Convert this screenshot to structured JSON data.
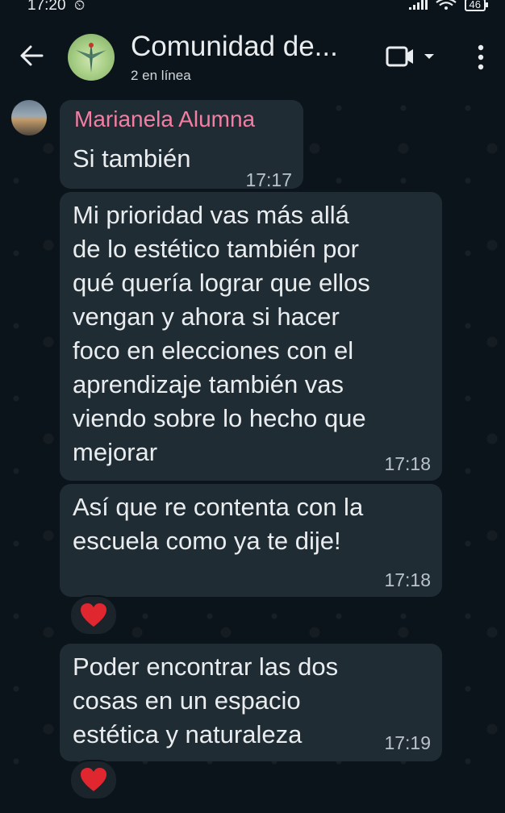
{
  "status": {
    "time": "17:20",
    "battery": "46"
  },
  "header": {
    "title": "Comunidad de...",
    "subtitle": "2 en línea"
  },
  "messages": [
    {
      "sender": "Marianela Alumna",
      "text": "Si también",
      "time": "17:17"
    },
    {
      "text": "Mi prioridad vas más allá\nde lo estético también por\nqué quería lograr que ellos\nvengan y ahora si hacer\nfoco en elecciones con el\naprendizaje también vas\nviendo sobre lo hecho que\nmejorar",
      "time": "17:18"
    },
    {
      "text": "Así que re contenta con la\nescuela como ya te dije!",
      "time": "17:18",
      "reaction": "heart-icon"
    },
    {
      "text": "Poder encontrar las dos\ncosas en un espacio\nestética y naturaleza",
      "time": "17:19",
      "reaction": "heart-icon"
    }
  ],
  "colors": {
    "background": "#0b141a",
    "bubble": "#202c33",
    "sender_name": "#f47ea3",
    "reaction_heart": "#e0262f"
  }
}
